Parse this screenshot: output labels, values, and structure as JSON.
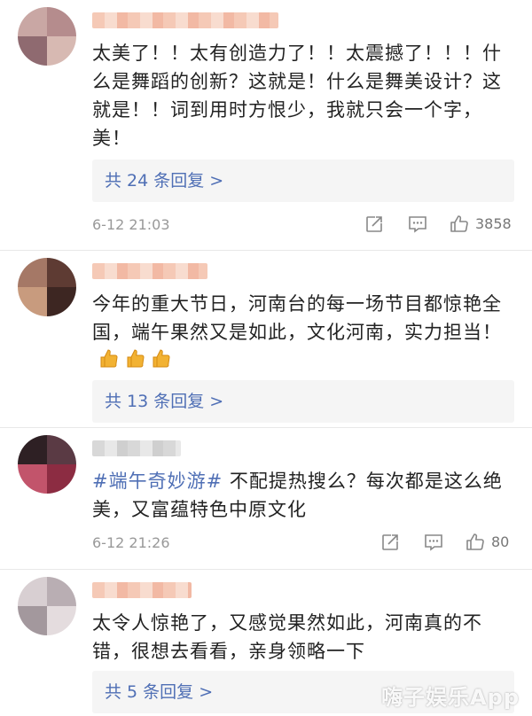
{
  "comments": [
    {
      "text": "太美了！！太有创造力了！！太震撼了！！！什么是舞蹈的创新？这就是！什么是舞美设计？这就是！！词到用时方恨少，我就只会一个字，美！",
      "reply_label": "共 24 条回复 >",
      "timestamp": "6-12 21:03",
      "likes": "3858"
    },
    {
      "text": "今年的重大节日，河南台的每一场节目都惊艳全国，端午果然又是如此，文化河南，实力担当！",
      "emoji": "thumbs-up-icon ×3",
      "reply_label": "共 13 条回复 >"
    },
    {
      "topic": "#端午奇妙游#",
      "text": " 不配提热搜么？每次都是这么绝美，又富蕴特色中原文化",
      "timestamp": "6-12 21:26",
      "likes": "80"
    },
    {
      "text": "太令人惊艳了，又感觉果然如此，河南真的不错，很想去看看，亲身领略一下",
      "reply_label": "共 5 条回复 >"
    }
  ],
  "watermark": "嗨子娱乐App",
  "colors": {
    "link": "#4f6fb5",
    "meta": "#999999",
    "reply_bg": "#f5f5f5"
  }
}
